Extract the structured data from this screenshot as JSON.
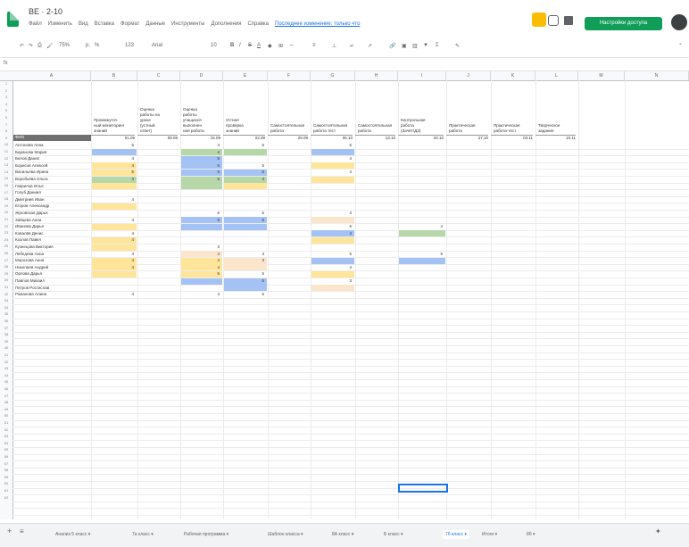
{
  "header": {
    "doc_title": "ВЕ · 2-10",
    "menus": [
      "Файл",
      "Изменить",
      "Вид",
      "Вставка",
      "Формат",
      "Данные",
      "Инструменты",
      "Дополнения",
      "Справка"
    ],
    "last_edit": "Последнее изменение: только что",
    "share_label": "Настройки доступа"
  },
  "toolbar": {
    "zoom": "75%",
    "font": "Arial",
    "font_size": "10",
    "format": "123"
  },
  "formula_bar": {
    "cell_ref": "A1",
    "value": ""
  },
  "columns": [
    "A",
    "B",
    "C",
    "D",
    "E",
    "F",
    "G",
    "H",
    "I",
    "J",
    "K",
    "L",
    "M",
    "N",
    "O"
  ],
  "table": {
    "headers": [
      "Промежуточ\nный мониторинг\nзнаний",
      "Оценка\nработы на\nуроке\n(устный\nответ)",
      "Оценка\nработы\nучащихся\nвыполнен\nная работа",
      "Устная\nпроверка\nзнаний",
      "Самостоятельная\nработа",
      "Самостоятельная\nработа тест",
      "Самостоятельная\nработа",
      "Контрольная\nработа\n(Зачёт/ДЗ)",
      "Практическая\nработа",
      "Практическая\nработа-тест",
      "Творческое\nзадание"
    ],
    "label_header": "ФИО",
    "dates": [
      "01.09",
      "08.09",
      "15.09",
      "22.09",
      "29.09",
      "06.10",
      "13.10",
      "20.10",
      "27.10",
      "03.11",
      "10.11"
    ],
    "students": [
      "Антонова Анна",
      "Баранова Мария",
      "Белов Данил",
      "Борисов Алексей",
      "Васильева Ирина",
      "Воробьёва Ольга",
      "Гаврилов Илья",
      "Голуб Даниил",
      "Дмитриев Иван",
      "Егоров Александр",
      "Жуковская Дарья",
      "Зайцева Анна",
      "Иванова Дарья",
      "Ковалёв Денис",
      "Козлов Павел",
      "Кузнецова Виктория",
      "Лебедева Анна",
      "Морозова Анна",
      "Николаев Андрей",
      "Орлова Дарья",
      "Павлов Михаил",
      "Петров Ростислав",
      "Романова Алина"
    ],
    "marks": [
      [
        "",
        "",
        "",
        "",
        "",
        "",
        "",
        "",
        "",
        "",
        ""
      ],
      [
        "5",
        "",
        "4",
        "5",
        "",
        "5",
        "",
        "",
        "",
        "",
        ""
      ],
      [
        "",
        "",
        "4",
        "",
        "",
        "",
        "",
        "",
        "",
        "",
        ""
      ],
      [
        "4",
        "",
        "5",
        "",
        "",
        "4",
        "",
        "",
        "",
        "",
        ""
      ],
      [
        "4",
        "",
        "5",
        "5",
        "",
        "",
        "",
        "",
        "",
        "",
        ""
      ],
      [
        "5",
        "",
        "5",
        "5",
        "",
        "4",
        "",
        "",
        "",
        "",
        ""
      ],
      [
        "4",
        "",
        "5",
        "4",
        "",
        "",
        "",
        "",
        "",
        "",
        ""
      ],
      [
        "",
        "",
        "",
        "",
        "",
        "",
        "",
        "",
        "",
        "",
        ""
      ],
      [
        "",
        "",
        "",
        "",
        "",
        "",
        "",
        "",
        "",
        "",
        ""
      ],
      [
        "4",
        "",
        "",
        "",
        "",
        "",
        "",
        "",
        "",
        "",
        ""
      ],
      [
        "",
        "",
        "",
        "",
        "",
        "",
        "",
        "",
        "",
        "",
        ""
      ],
      [
        "",
        "",
        "5",
        "5",
        "",
        "3",
        "",
        "",
        "",
        "",
        ""
      ],
      [
        "4",
        "",
        "5",
        "5",
        "",
        "",
        "",
        "",
        "",
        "",
        ""
      ],
      [
        "",
        "",
        "",
        "",
        "",
        "5",
        "",
        "4",
        "",
        "",
        ""
      ],
      [
        "4",
        "",
        "",
        "",
        "",
        "4",
        "",
        "",
        "",
        "",
        ""
      ],
      [
        "4",
        "",
        "",
        "",
        "",
        "",
        "",
        "",
        "",
        "",
        ""
      ],
      [
        "",
        "",
        "3",
        "",
        "",
        "",
        "",
        "",
        "",
        "",
        ""
      ],
      [
        "4",
        "",
        "4",
        "3",
        "",
        "5",
        "",
        "5",
        "",
        "",
        ""
      ],
      [
        "4",
        "",
        "4",
        "3",
        "",
        "",
        "",
        "",
        "",
        "",
        ""
      ],
      [
        "4",
        "",
        "4",
        "",
        "",
        "4",
        "",
        "",
        "",
        "",
        ""
      ],
      [
        "",
        "",
        "5",
        "5",
        "",
        "",
        "",
        "",
        "",
        "",
        ""
      ],
      [
        "",
        "",
        "",
        "5",
        "",
        "3",
        "",
        "",
        "",
        "",
        ""
      ],
      [
        "",
        "",
        "",
        "",
        "",
        "",
        "",
        "",
        "",
        "",
        ""
      ],
      [
        "4",
        "",
        "4",
        "5",
        "",
        "",
        "",
        "",
        "",
        "",
        ""
      ]
    ]
  },
  "tabs": [
    "Анализ 5 класс",
    "7а класс",
    "Рабочая программа",
    "Шаблон класса",
    "8А класс",
    "Б класс",
    "7б класс",
    "Итоги",
    "8б"
  ],
  "active_tab_index": 6,
  "colors": {
    "blue": "#a4c2f4",
    "green": "#b6d7a8",
    "yellow": "#ffe599",
    "peach": "#fce5cd",
    "accent": "#0f9d58"
  }
}
